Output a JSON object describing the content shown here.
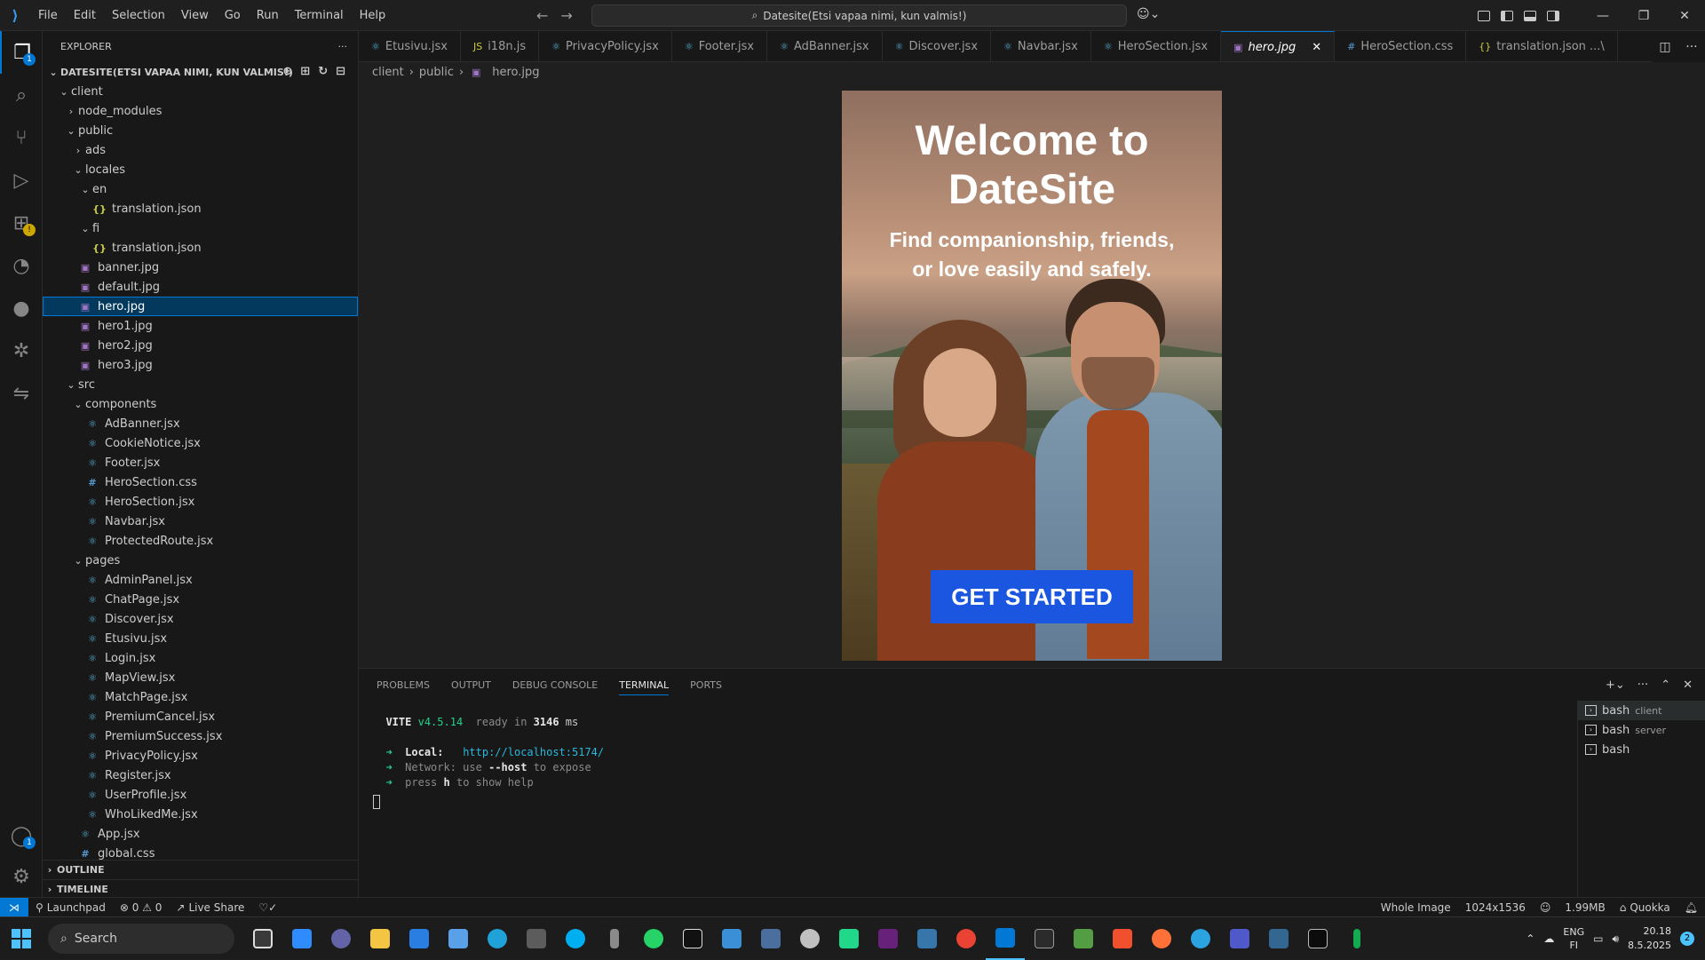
{
  "menu": [
    "File",
    "Edit",
    "Selection",
    "View",
    "Go",
    "Run",
    "Terminal",
    "Help"
  ],
  "command_center": "Datesite(Etsi vapaa nimi, kun valmis!)",
  "explorer": {
    "title": "EXPLORER",
    "root": "DATESITE(ETSI VAPAA NIMI, KUN VALMIS!)",
    "tree": [
      {
        "label": "client",
        "indent": 1,
        "chev": "⌄",
        "icon": ""
      },
      {
        "label": "node_modules",
        "indent": 2,
        "chev": "›",
        "icon": ""
      },
      {
        "label": "public",
        "indent": 2,
        "chev": "⌄",
        "icon": ""
      },
      {
        "label": "ads",
        "indent": 3,
        "chev": "›",
        "icon": ""
      },
      {
        "label": "locales",
        "indent": 3,
        "chev": "⌄",
        "icon": ""
      },
      {
        "label": "en",
        "indent": 4,
        "chev": "⌄",
        "icon": ""
      },
      {
        "label": "translation.json",
        "indent": 4,
        "chev": "",
        "icon": "json"
      },
      {
        "label": "fi",
        "indent": 4,
        "chev": "⌄",
        "icon": ""
      },
      {
        "label": "translation.json",
        "indent": 4,
        "chev": "",
        "icon": "json"
      },
      {
        "label": "banner.jpg",
        "indent": 2,
        "chev": "",
        "icon": "img"
      },
      {
        "label": "default.jpg",
        "indent": 2,
        "chev": "",
        "icon": "img"
      },
      {
        "label": "hero.jpg",
        "indent": 2,
        "chev": "",
        "icon": "img",
        "selected": true
      },
      {
        "label": "hero1.jpg",
        "indent": 2,
        "chev": "",
        "icon": "img"
      },
      {
        "label": "hero2.jpg",
        "indent": 2,
        "chev": "",
        "icon": "img"
      },
      {
        "label": "hero3.jpg",
        "indent": 2,
        "chev": "",
        "icon": "img"
      },
      {
        "label": "src",
        "indent": 2,
        "chev": "⌄",
        "icon": ""
      },
      {
        "label": "components",
        "indent": 3,
        "chev": "⌄",
        "icon": ""
      },
      {
        "label": "AdBanner.jsx",
        "indent": 3,
        "chev": "",
        "icon": "react"
      },
      {
        "label": "CookieNotice.jsx",
        "indent": 3,
        "chev": "",
        "icon": "react"
      },
      {
        "label": "Footer.jsx",
        "indent": 3,
        "chev": "",
        "icon": "react"
      },
      {
        "label": "HeroSection.css",
        "indent": 3,
        "chev": "",
        "icon": "css"
      },
      {
        "label": "HeroSection.jsx",
        "indent": 3,
        "chev": "",
        "icon": "react"
      },
      {
        "label": "Navbar.jsx",
        "indent": 3,
        "chev": "",
        "icon": "react"
      },
      {
        "label": "ProtectedRoute.jsx",
        "indent": 3,
        "chev": "",
        "icon": "react"
      },
      {
        "label": "pages",
        "indent": 3,
        "chev": "⌄",
        "icon": ""
      },
      {
        "label": "AdminPanel.jsx",
        "indent": 3,
        "chev": "",
        "icon": "react"
      },
      {
        "label": "ChatPage.jsx",
        "indent": 3,
        "chev": "",
        "icon": "react"
      },
      {
        "label": "Discover.jsx",
        "indent": 3,
        "chev": "",
        "icon": "react"
      },
      {
        "label": "Etusivu.jsx",
        "indent": 3,
        "chev": "",
        "icon": "react"
      },
      {
        "label": "Login.jsx",
        "indent": 3,
        "chev": "",
        "icon": "react"
      },
      {
        "label": "MapView.jsx",
        "indent": 3,
        "chev": "",
        "icon": "react"
      },
      {
        "label": "MatchPage.jsx",
        "indent": 3,
        "chev": "",
        "icon": "react"
      },
      {
        "label": "PremiumCancel.jsx",
        "indent": 3,
        "chev": "",
        "icon": "react"
      },
      {
        "label": "PremiumSuccess.jsx",
        "indent": 3,
        "chev": "",
        "icon": "react"
      },
      {
        "label": "PrivacyPolicy.jsx",
        "indent": 3,
        "chev": "",
        "icon": "react"
      },
      {
        "label": "Register.jsx",
        "indent": 3,
        "chev": "",
        "icon": "react"
      },
      {
        "label": "UserProfile.jsx",
        "indent": 3,
        "chev": "",
        "icon": "react"
      },
      {
        "label": "WhoLikedMe.jsx",
        "indent": 3,
        "chev": "",
        "icon": "react"
      },
      {
        "label": "App.jsx",
        "indent": 2,
        "chev": "",
        "icon": "react"
      },
      {
        "label": "global.css",
        "indent": 2,
        "chev": "",
        "icon": "css"
      }
    ],
    "outline": "OUTLINE",
    "timeline": "TIMELINE"
  },
  "tabs": [
    {
      "label": "Etusivu.jsx",
      "icon": "react"
    },
    {
      "label": "i18n.js",
      "icon": "js"
    },
    {
      "label": "PrivacyPolicy.jsx",
      "icon": "react"
    },
    {
      "label": "Footer.jsx",
      "icon": "react"
    },
    {
      "label": "AdBanner.jsx",
      "icon": "react"
    },
    {
      "label": "Discover.jsx",
      "icon": "react"
    },
    {
      "label": "Navbar.jsx",
      "icon": "react"
    },
    {
      "label": "HeroSection.jsx",
      "icon": "react"
    },
    {
      "label": "hero.jpg",
      "icon": "img",
      "active": true
    },
    {
      "label": "HeroSection.css",
      "icon": "css"
    },
    {
      "label": "translation.json ...\\",
      "icon": "json"
    }
  ],
  "breadcrumb": [
    "client",
    "public",
    "hero.jpg"
  ],
  "hero": {
    "title_line1": "Welcome to",
    "title_line2": "DateSite",
    "subtitle_line1": "Find companionship, friends,",
    "subtitle_line2": "or love easily and safely.",
    "button": "GET STARTED"
  },
  "panel": {
    "tabs": [
      "PROBLEMS",
      "OUTPUT",
      "DEBUG CONSOLE",
      "TERMINAL",
      "PORTS"
    ],
    "active_tab": "TERMINAL",
    "terminal": {
      "vite": "VITE",
      "version": "v4.5.14",
      "ready": "ready in",
      "ms": "3146",
      "ms_unit": "ms",
      "local_label": "Local:",
      "local_url": "http://localhost:5174/",
      "network_label": "Network:",
      "network_pre": "use",
      "network_flag": "--host",
      "network_post": "to expose",
      "press": "press",
      "press_key": "h",
      "press_post": "to show help"
    },
    "terminals": [
      {
        "name": "bash",
        "sub": "client",
        "active": true
      },
      {
        "name": "bash",
        "sub": "server"
      },
      {
        "name": "bash",
        "sub": ""
      }
    ]
  },
  "status": {
    "launchpad": "Launchpad",
    "problems": "⊗ 0 ⚠ 0",
    "liveshare": "Live Share",
    "whole_image": "Whole Image",
    "dims": "1024x1536",
    "size": "1.99MB",
    "quokka": "Quokka"
  },
  "taskbar": {
    "search": "Search",
    "lang1": "ENG",
    "lang2": "FI",
    "time": "20.18",
    "date": "8.5.2025",
    "notif": "2"
  },
  "badges": {
    "explorer": "1",
    "account": "1"
  },
  "colors": {
    "accent": "#0078d4",
    "cta": "#1a56e0"
  }
}
